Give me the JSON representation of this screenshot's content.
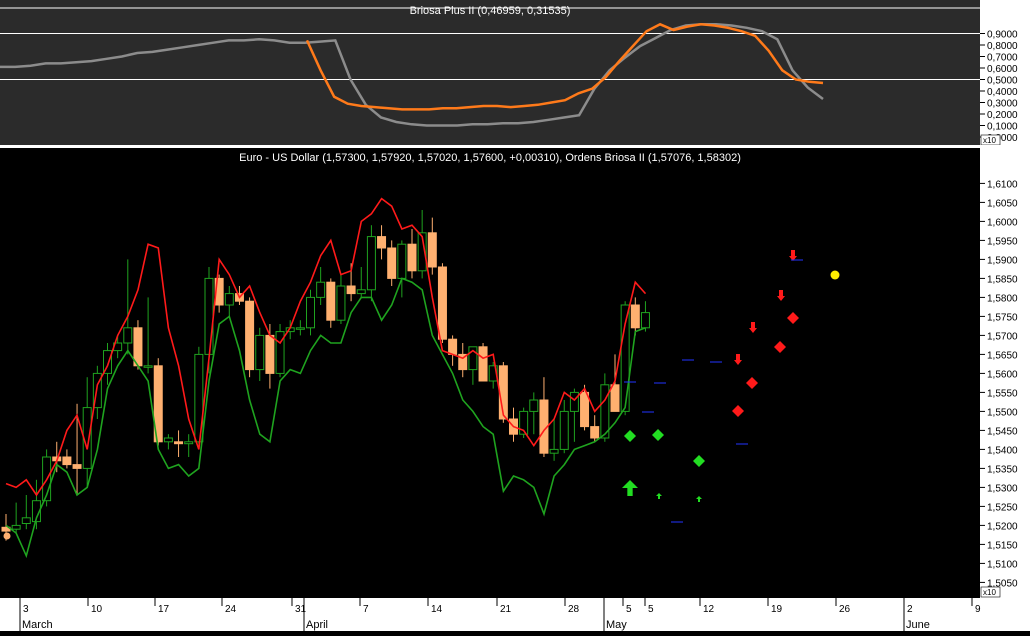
{
  "colors": {
    "upper_bg": "#2b2b2b",
    "lower_bg": "#000000",
    "axis_bg": "#ffffff",
    "text": "#ffffff",
    "axis_text": "#000000",
    "red_line": "#ff1a1a",
    "green_line": "#1fa31f",
    "bull_body": "#000000",
    "bear_body": "#ffb070",
    "orange": "#ff7a1a",
    "gray": "#8c8c8c"
  },
  "upper_panel": {
    "title": "Briosa Plus II (0,46959, 0,31535)",
    "multiplier": "x10",
    "yticks": [
      "0,9000",
      "0,8000",
      "0,7000",
      "0,6000",
      "0,5000",
      "0,4000",
      "0,3000",
      "0,2000",
      "0,1000",
      "0,0000"
    ],
    "hlines": [
      0.98,
      0.9,
      0.5
    ]
  },
  "main_panel": {
    "title": "Euro - US Dollar (1,57300, 1,57920, 1,57020, 1,57600, +0,00310), Ordens Briosa II (1,57076, 1,58302)",
    "yticks": [
      "1,6100",
      "1,6050",
      "1,6000",
      "1,5950",
      "1,5900",
      "1,5850",
      "1,5800",
      "1,5750",
      "1,5700",
      "1,5650",
      "1,5600",
      "1,5550",
      "1,5500",
      "1,5450",
      "1,5400",
      "1,5350",
      "1,5300",
      "1,5250",
      "1,5200",
      "1,5150",
      "1,5100",
      "1,5050"
    ],
    "multiplier": "x10",
    "ylim": [
      1.503,
      1.614
    ]
  },
  "x_axis": {
    "day_labels": [
      "3",
      "10",
      "17",
      "24",
      "31",
      "7",
      "14",
      "21",
      "28",
      "5",
      "5",
      "12",
      "19",
      "26",
      "2",
      "9"
    ],
    "month_labels": [
      "March",
      "April",
      "May",
      "June"
    ]
  },
  "chart_data": {
    "type": "candlestick",
    "candles": [
      {
        "o": 1.5195,
        "h": 1.523,
        "l": 1.516,
        "c": 1.5185
      },
      {
        "o": 1.519,
        "h": 1.526,
        "l": 1.518,
        "c": 1.52
      },
      {
        "o": 1.5205,
        "h": 1.528,
        "l": 1.519,
        "c": 1.522
      },
      {
        "o": 1.521,
        "h": 1.532,
        "l": 1.519,
        "c": 1.5265
      },
      {
        "o": 1.5265,
        "h": 1.54,
        "l": 1.525,
        "c": 1.538
      },
      {
        "o": 1.538,
        "h": 1.542,
        "l": 1.534,
        "c": 1.537
      },
      {
        "o": 1.538,
        "h": 1.54,
        "l": 1.535,
        "c": 1.536
      },
      {
        "o": 1.536,
        "h": 1.552,
        "l": 1.528,
        "c": 1.535
      },
      {
        "o": 1.535,
        "h": 1.559,
        "l": 1.53,
        "c": 1.551
      },
      {
        "o": 1.551,
        "h": 1.562,
        "l": 1.548,
        "c": 1.56
      },
      {
        "o": 1.56,
        "h": 1.568,
        "l": 1.557,
        "c": 1.566
      },
      {
        "o": 1.566,
        "h": 1.57,
        "l": 1.564,
        "c": 1.568
      },
      {
        "o": 1.568,
        "h": 1.59,
        "l": 1.565,
        "c": 1.572
      },
      {
        "o": 1.572,
        "h": 1.574,
        "l": 1.561,
        "c": 1.562
      },
      {
        "o": 1.562,
        "h": 1.58,
        "l": 1.56,
        "c": 1.562
      },
      {
        "o": 1.562,
        "h": 1.564,
        "l": 1.541,
        "c": 1.542
      },
      {
        "o": 1.542,
        "h": 1.544,
        "l": 1.54,
        "c": 1.543
      },
      {
        "o": 1.542,
        "h": 1.545,
        "l": 1.538,
        "c": 1.5415
      },
      {
        "o": 1.5415,
        "h": 1.544,
        "l": 1.538,
        "c": 1.542
      },
      {
        "o": 1.542,
        "h": 1.567,
        "l": 1.54,
        "c": 1.565
      },
      {
        "o": 1.565,
        "h": 1.588,
        "l": 1.56,
        "c": 1.585
      },
      {
        "o": 1.585,
        "h": 1.586,
        "l": 1.576,
        "c": 1.578
      },
      {
        "o": 1.578,
        "h": 1.583,
        "l": 1.575,
        "c": 1.581
      },
      {
        "o": 1.581,
        "h": 1.583,
        "l": 1.578,
        "c": 1.579
      },
      {
        "o": 1.579,
        "h": 1.58,
        "l": 1.559,
        "c": 1.561
      },
      {
        "o": 1.561,
        "h": 1.572,
        "l": 1.558,
        "c": 1.57
      },
      {
        "o": 1.57,
        "h": 1.573,
        "l": 1.556,
        "c": 1.56
      },
      {
        "o": 1.56,
        "h": 1.573,
        "l": 1.559,
        "c": 1.571
      },
      {
        "o": 1.571,
        "h": 1.574,
        "l": 1.569,
        "c": 1.572
      },
      {
        "o": 1.572,
        "h": 1.574,
        "l": 1.57,
        "c": 1.572
      },
      {
        "o": 1.572,
        "h": 1.582,
        "l": 1.57,
        "c": 1.58
      },
      {
        "o": 1.58,
        "h": 1.588,
        "l": 1.578,
        "c": 1.584
      },
      {
        "o": 1.584,
        "h": 1.585,
        "l": 1.572,
        "c": 1.574
      },
      {
        "o": 1.574,
        "h": 1.586,
        "l": 1.573,
        "c": 1.583
      },
      {
        "o": 1.583,
        "h": 1.589,
        "l": 1.579,
        "c": 1.581
      },
      {
        "o": 1.581,
        "h": 1.588,
        "l": 1.58,
        "c": 1.582
      },
      {
        "o": 1.582,
        "h": 1.599,
        "l": 1.579,
        "c": 1.596
      },
      {
        "o": 1.596,
        "h": 1.599,
        "l": 1.59,
        "c": 1.593
      },
      {
        "o": 1.593,
        "h": 1.595,
        "l": 1.583,
        "c": 1.585
      },
      {
        "o": 1.585,
        "h": 1.595,
        "l": 1.58,
        "c": 1.594
      },
      {
        "o": 1.594,
        "h": 1.598,
        "l": 1.585,
        "c": 1.587
      },
      {
        "o": 1.587,
        "h": 1.603,
        "l": 1.585,
        "c": 1.597
      },
      {
        "o": 1.597,
        "h": 1.601,
        "l": 1.586,
        "c": 1.588
      },
      {
        "o": 1.588,
        "h": 1.589,
        "l": 1.568,
        "c": 1.569
      },
      {
        "o": 1.569,
        "h": 1.57,
        "l": 1.562,
        "c": 1.565
      },
      {
        "o": 1.565,
        "h": 1.568,
        "l": 1.559,
        "c": 1.561
      },
      {
        "o": 1.561,
        "h": 1.567,
        "l": 1.557,
        "c": 1.567
      },
      {
        "o": 1.567,
        "h": 1.568,
        "l": 1.558,
        "c": 1.558
      },
      {
        "o": 1.558,
        "h": 1.563,
        "l": 1.556,
        "c": 1.562
      },
      {
        "o": 1.562,
        "h": 1.563,
        "l": 1.547,
        "c": 1.548
      },
      {
        "o": 1.548,
        "h": 1.551,
        "l": 1.542,
        "c": 1.544
      },
      {
        "o": 1.544,
        "h": 1.551,
        "l": 1.543,
        "c": 1.55
      },
      {
        "o": 1.55,
        "h": 1.555,
        "l": 1.544,
        "c": 1.553
      },
      {
        "o": 1.553,
        "h": 1.559,
        "l": 1.538,
        "c": 1.539
      },
      {
        "o": 1.539,
        "h": 1.548,
        "l": 1.537,
        "c": 1.54
      },
      {
        "o": 1.54,
        "h": 1.553,
        "l": 1.539,
        "c": 1.55
      },
      {
        "o": 1.55,
        "h": 1.556,
        "l": 1.542,
        "c": 1.555
      },
      {
        "o": 1.555,
        "h": 1.557,
        "l": 1.545,
        "c": 1.546
      },
      {
        "o": 1.546,
        "h": 1.549,
        "l": 1.542,
        "c": 1.543
      },
      {
        "o": 1.543,
        "h": 1.56,
        "l": 1.542,
        "c": 1.557
      },
      {
        "o": 1.557,
        "h": 1.565,
        "l": 1.55,
        "c": 1.55
      },
      {
        "o": 1.55,
        "h": 1.579,
        "l": 1.549,
        "c": 1.578
      },
      {
        "o": 1.578,
        "h": 1.58,
        "l": 1.57,
        "c": 1.572
      },
      {
        "o": 1.572,
        "h": 1.579,
        "l": 1.571,
        "c": 1.576
      }
    ],
    "red_line": [
      1.531,
      1.53,
      1.532,
      1.528,
      1.532,
      1.537,
      1.545,
      1.549,
      1.54,
      1.557,
      1.562,
      1.57,
      1.575,
      1.582,
      1.594,
      1.593,
      1.572,
      1.562,
      1.548,
      1.54,
      1.564,
      1.59,
      1.586,
      1.58,
      1.583,
      1.576,
      1.57,
      1.568,
      1.572,
      1.579,
      1.584,
      1.591,
      1.595,
      1.586,
      1.587,
      1.6,
      1.602,
      1.606,
      1.604,
      1.598,
      1.599,
      1.596,
      1.58,
      1.566,
      1.565,
      1.564,
      1.566,
      1.564,
      1.565,
      1.549,
      1.546,
      1.545,
      1.541,
      1.545,
      1.548,
      1.555,
      1.553,
      1.556,
      1.55,
      1.553,
      1.558,
      1.573,
      1.584,
      1.581
    ],
    "green_line": [
      1.52,
      1.518,
      1.512,
      1.522,
      1.528,
      1.536,
      1.534,
      1.528,
      1.53,
      1.54,
      1.556,
      1.562,
      1.566,
      1.562,
      1.558,
      1.54,
      1.535,
      1.536,
      1.533,
      1.535,
      1.558,
      1.573,
      1.575,
      1.566,
      1.553,
      1.544,
      1.542,
      1.558,
      1.561,
      1.56,
      1.566,
      1.57,
      1.568,
      1.568,
      1.576,
      1.58,
      1.58,
      1.574,
      1.578,
      1.585,
      1.584,
      1.582,
      1.57,
      1.565,
      1.56,
      1.553,
      1.55,
      1.546,
      1.544,
      1.529,
      1.533,
      1.532,
      1.53,
      1.523,
      1.533,
      1.536,
      1.54,
      1.541,
      1.542,
      1.544,
      1.547,
      1.551,
      1.571,
      1.572
    ],
    "osc_orange": [
      0.84,
      0.58,
      0.35,
      0.29,
      0.27,
      0.26,
      0.25,
      0.24,
      0.24,
      0.24,
      0.25,
      0.25,
      0.26,
      0.27,
      0.27,
      0.26,
      0.27,
      0.28,
      0.3,
      0.32,
      0.38,
      0.42,
      0.52,
      0.66,
      0.79,
      0.92,
      0.98,
      0.93,
      0.96,
      0.98,
      0.97,
      0.95,
      0.92,
      0.88,
      0.75,
      0.58,
      0.5,
      0.48,
      0.47
    ],
    "osc_gray": [
      0.61,
      0.61,
      0.62,
      0.64,
      0.64,
      0.65,
      0.66,
      0.68,
      0.7,
      0.73,
      0.74,
      0.76,
      0.78,
      0.8,
      0.82,
      0.84,
      0.84,
      0.85,
      0.84,
      0.82,
      0.82,
      0.83,
      0.84,
      0.5,
      0.28,
      0.17,
      0.13,
      0.11,
      0.1,
      0.1,
      0.1,
      0.11,
      0.11,
      0.12,
      0.12,
      0.13,
      0.15,
      0.17,
      0.19,
      0.42,
      0.58,
      0.69,
      0.79,
      0.86,
      0.93,
      0.97,
      0.98,
      0.98,
      0.97,
      0.95,
      0.92,
      0.85,
      0.58,
      0.43,
      0.33
    ]
  }
}
